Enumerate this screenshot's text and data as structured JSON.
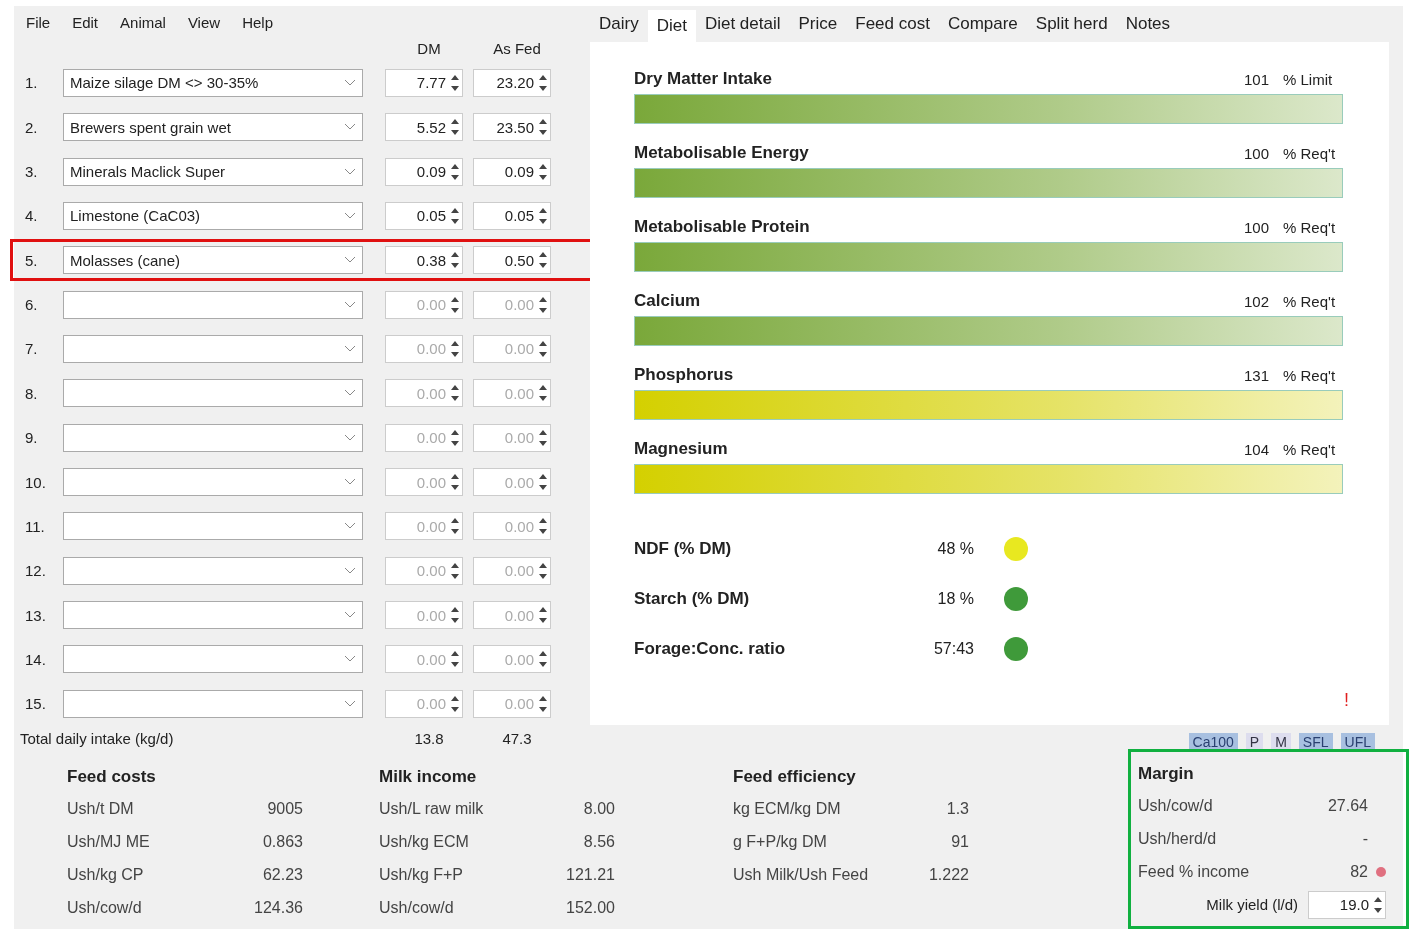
{
  "menu": [
    "File",
    "Edit",
    "Animal",
    "View",
    "Help"
  ],
  "columns": {
    "dm": "DM",
    "as_fed": "As Fed"
  },
  "feeds": [
    {
      "number": "1.",
      "name": "Maize silage DM <> 30-35%",
      "dm": "7.77",
      "as_fed": "23.20",
      "disabled": false,
      "highlighted": false
    },
    {
      "number": "2.",
      "name": "Brewers spent grain wet",
      "dm": "5.52",
      "as_fed": "23.50",
      "disabled": false,
      "highlighted": false
    },
    {
      "number": "3.",
      "name": "Minerals Maclick Super",
      "dm": "0.09",
      "as_fed": "0.09",
      "disabled": false,
      "highlighted": false
    },
    {
      "number": "4.",
      "name": "Limestone (CaC03)",
      "dm": "0.05",
      "as_fed": "0.05",
      "disabled": false,
      "highlighted": false
    },
    {
      "number": "5.",
      "name": "Molasses (cane)",
      "dm": "0.38",
      "as_fed": "0.50",
      "disabled": false,
      "highlighted": true
    },
    {
      "number": "6.",
      "dm": "0.00",
      "as_fed": "0.00",
      "disabled": true,
      "highlighted": false
    },
    {
      "number": "7.",
      "dm": "0.00",
      "as_fed": "0.00",
      "disabled": true,
      "highlighted": false
    },
    {
      "number": "8.",
      "dm": "0.00",
      "as_fed": "0.00",
      "disabled": true,
      "highlighted": false
    },
    {
      "number": "9.",
      "dm": "0.00",
      "as_fed": "0.00",
      "disabled": true,
      "highlighted": false
    },
    {
      "number": "10.",
      "dm": "0.00",
      "as_fed": "0.00",
      "disabled": true,
      "highlighted": false
    },
    {
      "number": "11.",
      "dm": "0.00",
      "as_fed": "0.00",
      "disabled": true,
      "highlighted": false
    },
    {
      "number": "12.",
      "dm": "0.00",
      "as_fed": "0.00",
      "disabled": true,
      "highlighted": false
    },
    {
      "number": "13.",
      "dm": "0.00",
      "as_fed": "0.00",
      "disabled": true,
      "highlighted": false
    },
    {
      "number": "14.",
      "dm": "0.00",
      "as_fed": "0.00",
      "disabled": true,
      "highlighted": false
    },
    {
      "number": "15.",
      "dm": "0.00",
      "as_fed": "0.00",
      "disabled": true,
      "highlighted": false
    }
  ],
  "total": {
    "label": "Total daily intake (kg/d)",
    "dm": "13.8",
    "as_fed": "47.3"
  },
  "tabs": [
    {
      "label": "Dairy",
      "selected": false
    },
    {
      "label": "Diet",
      "selected": true
    },
    {
      "label": "Diet detail",
      "selected": false
    },
    {
      "label": "Price",
      "selected": false
    },
    {
      "label": "Feed cost",
      "selected": false
    },
    {
      "label": "Compare",
      "selected": false
    },
    {
      "label": "Split herd",
      "selected": false
    },
    {
      "label": "Notes",
      "selected": false
    }
  ],
  "metrics": [
    {
      "name": "Dry Matter Intake",
      "value": "101",
      "unit": "% Limit",
      "color": "#7aa83a"
    },
    {
      "name": "Metabolisable Energy",
      "value": "100",
      "unit": "% Req't",
      "color": "#7aa83a"
    },
    {
      "name": "Metabolisable Protein",
      "value": "100",
      "unit": "% Req't",
      "color": "#7aa83a"
    },
    {
      "name": "Calcium",
      "value": "102",
      "unit": "% Req't",
      "color": "#7aa83a"
    },
    {
      "name": "Phosphorus",
      "value": "131",
      "unit": "% Req't",
      "color": "#d4d000"
    },
    {
      "name": "Magnesium",
      "value": "104",
      "unit": "% Req't",
      "color": "#d4d000"
    }
  ],
  "indicators": [
    {
      "name": "NDF (% DM)",
      "value": "48 %",
      "color": "#e8e820"
    },
    {
      "name": "Starch (% DM)",
      "value": "18 %",
      "color": "#3f9a3a"
    },
    {
      "name": "Forage:Conc. ratio",
      "value": "57:43",
      "color": "#3f9a3a"
    }
  ],
  "warning": "!",
  "units": [
    {
      "label": "Ca100",
      "selected": true
    },
    {
      "label": "P",
      "selected": false
    },
    {
      "label": "M",
      "selected": false
    },
    {
      "label": "SFL",
      "selected": true
    },
    {
      "label": "UFL",
      "selected": true
    }
  ],
  "summaries": [
    {
      "title": "Feed costs",
      "highlighted": false,
      "rows": [
        {
          "label": "Ush/t DM",
          "value": "9005"
        },
        {
          "label": "Ush/MJ ME",
          "value": "0.863"
        },
        {
          "label": "Ush/kg CP",
          "value": "62.23"
        },
        {
          "label": "Ush/cow/d",
          "value": "124.36"
        }
      ]
    },
    {
      "title": "Milk income",
      "highlighted": false,
      "rows": [
        {
          "label": "Ush/L raw milk",
          "value": "8.00"
        },
        {
          "label": "Ush/kg ECM",
          "value": "8.56"
        },
        {
          "label": "Ush/kg F+P",
          "value": "121.21"
        },
        {
          "label": "Ush/cow/d",
          "value": "152.00"
        }
      ]
    },
    {
      "title": "Feed efficiency",
      "highlighted": false,
      "rows": [
        {
          "label": "kg ECM/kg DM",
          "value": "1.3"
        },
        {
          "label": "g F+P/kg DM",
          "value": "91"
        },
        {
          "label": "Ush Milk/Ush Feed",
          "value": "1.222"
        }
      ]
    },
    {
      "title": "Margin",
      "highlighted": true,
      "rows": [
        {
          "label": "Ush/cow/d",
          "value": "27.64"
        },
        {
          "label": "Ush/herd/d",
          "value": "-"
        },
        {
          "label": "Feed % income",
          "value": "82",
          "color": "#e07080"
        }
      ]
    }
  ],
  "milk_yield": {
    "label": "Milk yield (l/d)",
    "value": "19.0"
  }
}
